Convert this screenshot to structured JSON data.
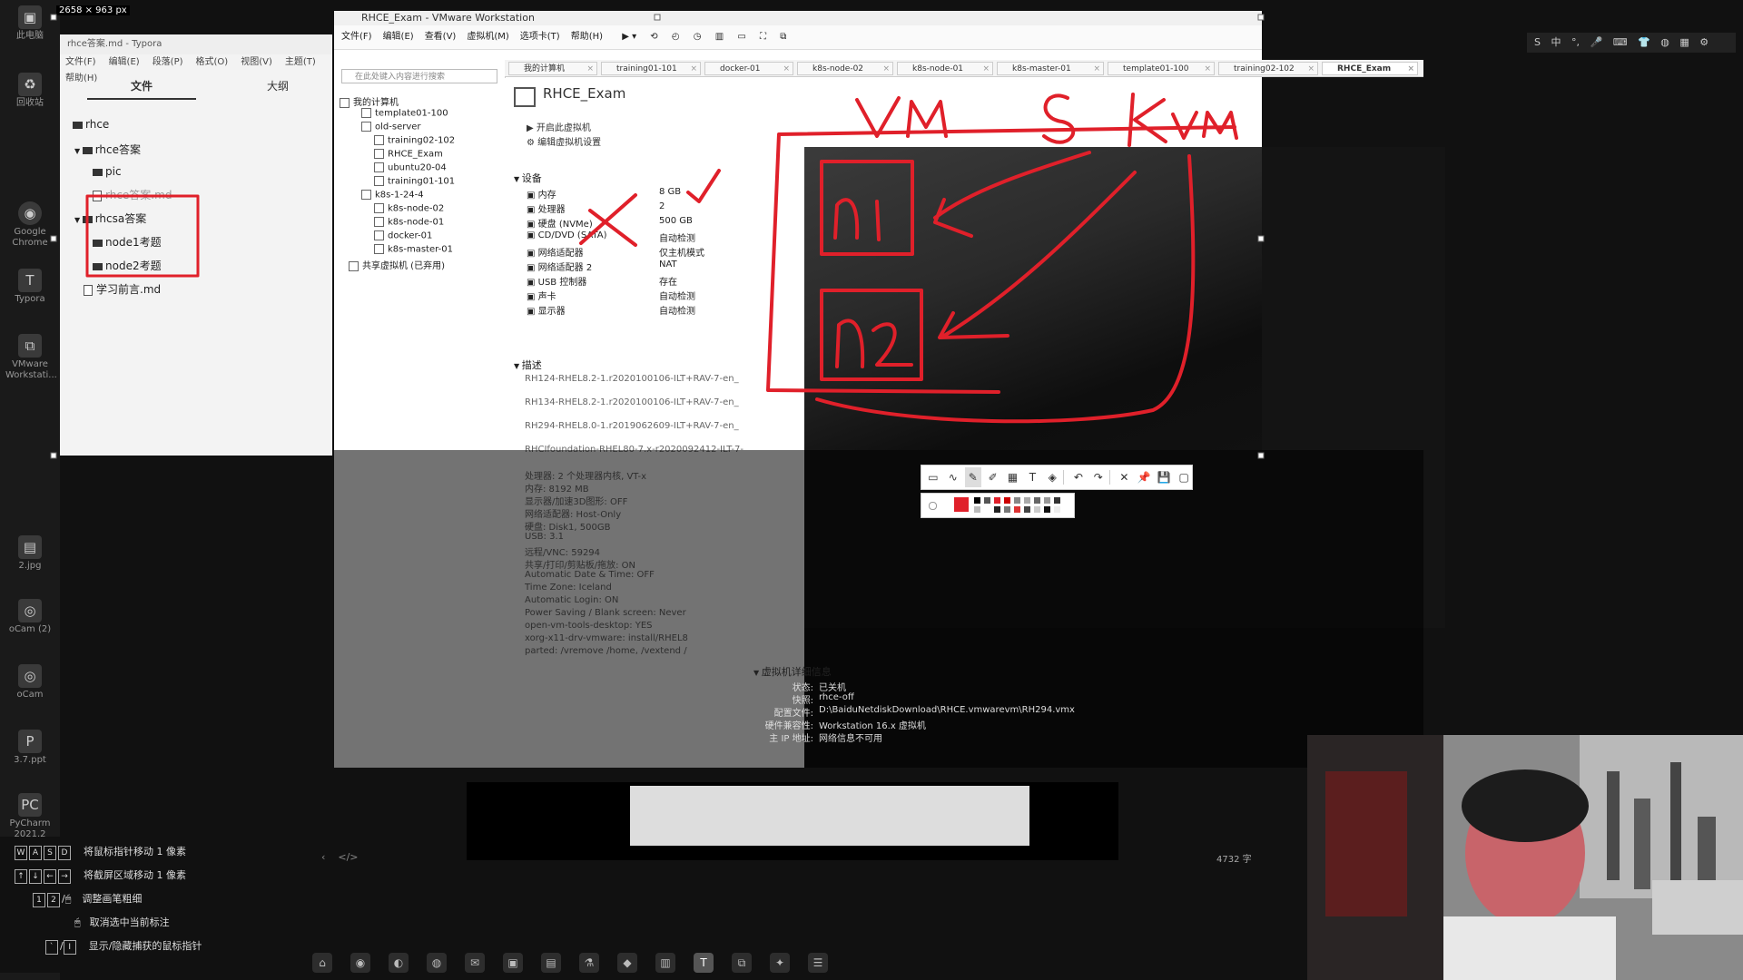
{
  "selection_size": "2658 × 963  px",
  "desktop_icons": [
    {
      "label": "此电脑",
      "icon": "computer-icon"
    },
    {
      "label": "回收站",
      "icon": "recycle-bin-icon"
    },
    {
      "label": "Google Chrome",
      "icon": "chrome-icon"
    },
    {
      "label": "Typora",
      "icon": "typora-icon"
    },
    {
      "label": "VMware Workstati...",
      "icon": "vmware-icon"
    },
    {
      "label": "2.jpg",
      "icon": "image-icon"
    },
    {
      "label": "oCam (2)",
      "icon": "ocam-icon"
    },
    {
      "label": "oCam",
      "icon": "ocam-icon"
    },
    {
      "label": "3.7.ppt",
      "icon": "ppt-icon"
    },
    {
      "label": "PyCharm 2021.2",
      "icon": "pycharm-icon"
    }
  ],
  "typora": {
    "title": "rhce答案.md - Typora",
    "menu": [
      "文件(F)",
      "编辑(E)",
      "段落(P)",
      "格式(O)",
      "视图(V)",
      "主题(T)",
      "帮助(H)"
    ],
    "tabs": [
      "文件",
      "大纲"
    ],
    "tree": [
      {
        "label": "rhce",
        "type": "folder",
        "indent": 0
      },
      {
        "label": "rhce答案",
        "type": "folder",
        "indent": 1
      },
      {
        "label": "pic",
        "type": "folder",
        "indent": 2
      },
      {
        "label": "rhce答案.md",
        "type": "file",
        "indent": 2
      },
      {
        "label": "rhcsa答案",
        "type": "folder",
        "indent": 1
      },
      {
        "label": "node1考题",
        "type": "folder",
        "indent": 2
      },
      {
        "label": "node2考题",
        "type": "folder",
        "indent": 2
      },
      {
        "label": "学习前言.md",
        "type": "file",
        "indent": 1
      }
    ]
  },
  "vmware": {
    "title": "RHCE_Exam - VMware Workstation",
    "menu": [
      "文件(F)",
      "编辑(E)",
      "查看(V)",
      "虚拟机(M)",
      "选项卡(T)",
      "帮助(H)"
    ],
    "search_placeholder": "在此处键入内容进行搜索",
    "library": [
      {
        "label": "我的计算机",
        "indent": 0
      },
      {
        "label": "template01-100",
        "indent": 1
      },
      {
        "label": "old-server",
        "indent": 1
      },
      {
        "label": "training02-102",
        "indent": 2
      },
      {
        "label": "RHCE_Exam",
        "indent": 2
      },
      {
        "label": "ubuntu20-04",
        "indent": 2
      },
      {
        "label": "training01-101",
        "indent": 2
      },
      {
        "label": "k8s-1-24-4",
        "indent": 1
      },
      {
        "label": "k8s-node-02",
        "indent": 2
      },
      {
        "label": "k8s-node-01",
        "indent": 2
      },
      {
        "label": "docker-01",
        "indent": 2
      },
      {
        "label": "k8s-master-01",
        "indent": 2
      },
      {
        "label": "共享虚拟机 (已弃用)",
        "indent": 0
      }
    ],
    "tabs": [
      "我的计算机",
      "training01-101",
      "docker-01",
      "k8s-node-02",
      "k8s-node-01",
      "k8s-master-01",
      "template01-100",
      "training02-102",
      "RHCE_Exam"
    ],
    "vm_name": "RHCE_Exam",
    "actions": [
      "开启此虚拟机",
      "编辑虚拟机设置"
    ],
    "devices_header": "设备",
    "devices": [
      {
        "name": "内存",
        "value": "8 GB"
      },
      {
        "name": "处理器",
        "value": "2"
      },
      {
        "name": "硬盘 (NVMe)",
        "value": "500 GB"
      },
      {
        "name": "CD/DVD (SATA)",
        "value": "自动检测"
      },
      {
        "name": "网络适配器",
        "value": "仅主机模式"
      },
      {
        "name": "网络适配器 2",
        "value": "NAT"
      },
      {
        "name": "USB 控制器",
        "value": "存在"
      },
      {
        "name": "声卡",
        "value": "自动检测"
      },
      {
        "name": "显示器",
        "value": "自动检测"
      }
    ],
    "description_header": "描述",
    "description_lines": [
      "RH124-RHEL8.2-1.r2020100106-ILT+RAV-7-en_",
      "RH134-RHEL8.2-1.r2020100106-ILT+RAV-7-en_",
      "RH294-RHEL8.0-1.r2019062609-ILT+RAV-7-en_",
      "RHCIfoundation-RHEL80-7.x-r2020092412-ILT-7-",
      "处理器: 2 个处理器内核, VT-x",
      "内存: 8192 MB",
      "显示器/加速3D图形: OFF",
      "网络适配器: Host-Only",
      "硬盘: Disk1, 500GB",
      "USB: 3.1",
      "远程/VNC: 59294",
      "共享/打印/剪贴板/拖放: ON",
      "Automatic Date & Time: OFF",
      "Time Zone: Iceland",
      "Automatic Login: ON",
      "Power Saving / Blank screen: Never",
      "open-vm-tools-desktop: YES",
      "xorg-x11-drv-vmware: install/RHEL8",
      "parted: /vremove /home, /vextend /"
    ],
    "details_header": "虚拟机详细信息",
    "details": [
      {
        "label": "状态:",
        "value": "已关机"
      },
      {
        "label": "快照:",
        "value": "rhce-off"
      },
      {
        "label": "配置文件:",
        "value": "D:\\BaiduNetdiskDownload\\RHCE.vmwarevm\\RH294.vmx"
      },
      {
        "label": "硬件兼容性:",
        "value": "Workstation 16.x 虚拟机"
      },
      {
        "label": "主 IP 地址:",
        "value": "网络信息不可用"
      }
    ]
  },
  "annotations": {
    "text_top": "vm & kvm",
    "box1": "n1",
    "box2": "n2",
    "color": "#e0202a"
  },
  "annotation_tools": [
    "rect-icon",
    "line-icon",
    "pen-icon",
    "marker-icon",
    "mosaic-icon",
    "text-icon",
    "eraser-icon",
    "undo-icon",
    "redo-icon",
    "close-icon",
    "pin-icon",
    "save-icon",
    "copy-icon"
  ],
  "tray": [
    "S",
    "中",
    "°,",
    "mic",
    "keyboard",
    "shirt",
    "gamepad",
    "grid",
    "gear"
  ],
  "hints": [
    {
      "keys": [
        "W",
        "A",
        "S",
        "D"
      ],
      "text": "将鼠标指针移动 1 像素"
    },
    {
      "keys": [
        "↑",
        "↓",
        "←",
        "→"
      ],
      "text": "将截屏区域移动 1 像素"
    },
    {
      "keys": [
        "1",
        "2",
        "/"
      ],
      "text": "调整画笔粗细"
    },
    {
      "keys": [],
      "text": "取消选中当前标注"
    },
    {
      "keys": [
        "`",
        "/"
      ],
      "text": "显示/隐藏捕获的鼠标指针"
    }
  ],
  "status_bottom": "4732 字"
}
